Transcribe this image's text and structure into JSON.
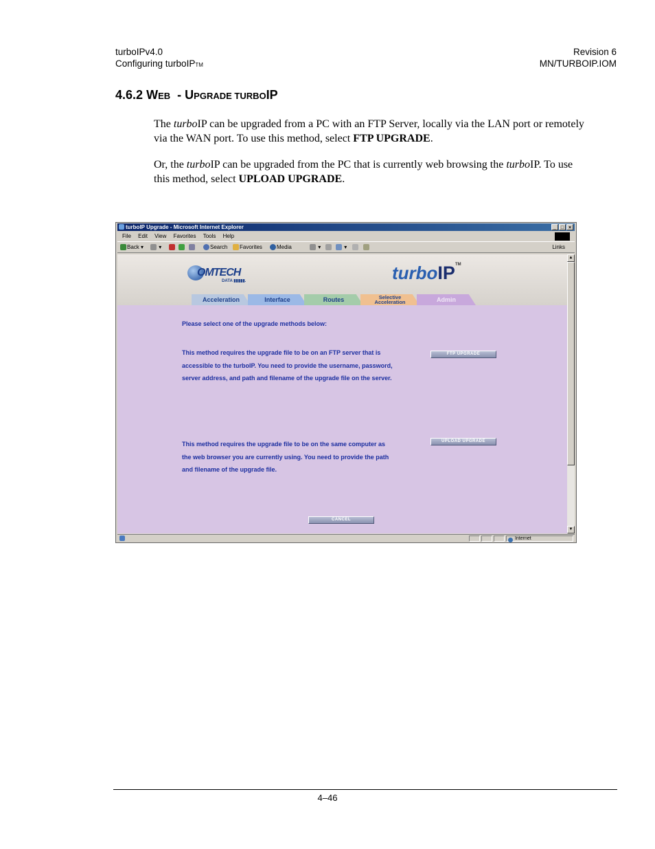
{
  "header": {
    "left_line1": "turboIPv4.0",
    "left_line2": "Configuring turboIP",
    "left_tm": "TM",
    "right_line1": "Revision 6",
    "right_line2": "MN/TURBOIP.IOM"
  },
  "section": {
    "number": "4.6.2",
    "w": "W",
    "eb": "EB",
    "dash": "-",
    "u": "U",
    "pgrade": "PGRADE TURBO",
    "ip": "IP"
  },
  "para1": {
    "a": "The ",
    "turbo": "turbo",
    "b": "IP can be upgraded from a PC with an FTP Server, locally via the LAN port or remotely via the WAN port. To use this method, select ",
    "bold": "FTP UPGRADE",
    "c": "."
  },
  "para2": {
    "a": "Or, the ",
    "turbo1": "turbo",
    "b": "IP can be upgraded from the PC that is currently web browsing the ",
    "turbo2": "turbo",
    "c": "IP. To use this method, select ",
    "bold": "UPLOAD UPGRADE",
    "d": "."
  },
  "browser": {
    "title": "turboIP Upgrade - Microsoft Internet Explorer",
    "menu": [
      "File",
      "Edit",
      "View",
      "Favorites",
      "Tools",
      "Help"
    ],
    "toolbar": {
      "back": "Back",
      "search": "Search",
      "favorites": "Favorites",
      "media": "Media",
      "links": "Links"
    },
    "status_zone": "Internet"
  },
  "app": {
    "logo_name": "OMTECH",
    "logo_sub": "DATA",
    "brand_turbo": "turbo",
    "brand_ip": "IP",
    "brand_tm": "TM",
    "tabs": {
      "acceleration": "Acceleration",
      "interface": "Interface",
      "routes": "Routes",
      "selective_1": "Selective",
      "selective_2": "Acceleration",
      "admin": "Admin"
    },
    "prompt": "Please select one of the upgrade methods below:",
    "ftp_text": [
      "This method requires the upgrade file to be on an FTP server that is",
      "accessible to the turboIP. You need to provide the username, password,",
      "server address, and path and filename of the upgrade file on the server."
    ],
    "upload_text": [
      "This method requires the upgrade file to be on the same computer as",
      "the web browser you are currently using. You need to provide the path",
      "and filename of the upgrade file."
    ],
    "ftp_button": "FTP UPGRADE",
    "upload_button": "UPLOAD UPGRADE",
    "cancel_button": "CANCEL"
  },
  "colors": {
    "content_bg": "#d7c5e4",
    "text_blue": "#1c2fa0"
  },
  "footer": {
    "page": "4–46"
  }
}
